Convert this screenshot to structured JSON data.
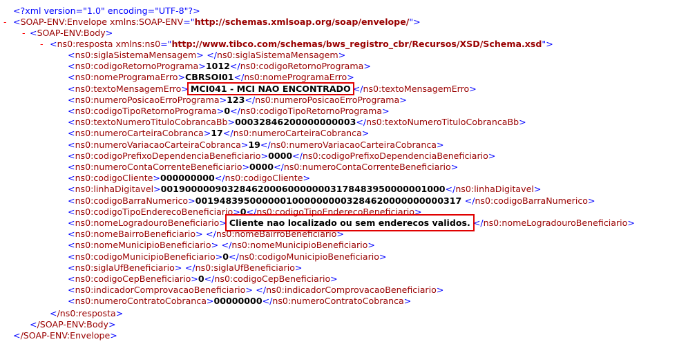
{
  "xml_decl": "<?xml version=\"1.0\" encoding=\"UTF-8\"?>",
  "toggle_symbol": "-",
  "envelope": {
    "open_tag": "SOAP-ENV:Envelope",
    "attr_name": "xmlns:SOAP-ENV",
    "attr_value": "http://schemas.xmlsoap.org/soap/envelope/",
    "close_tag": "/SOAP-ENV:Envelope"
  },
  "body": {
    "open_tag": "SOAP-ENV:Body",
    "close_tag": "/SOAP-ENV:Body"
  },
  "resposta": {
    "open_tag": "ns0:resposta",
    "attr_name": "xmlns:ns0",
    "attr_value": "http://www.tibco.com/schemas/bws_registro_cbr/Recursos/XSD/Schema.xsd",
    "close_tag": "/ns0:resposta"
  },
  "fields": [
    {
      "tag": "ns0:siglaSistemaMensagem",
      "value": " "
    },
    {
      "tag": "ns0:codigoRetornoPrograma",
      "value": "1012"
    },
    {
      "tag": "ns0:nomeProgramaErro",
      "value": "CBRSOI01"
    },
    {
      "tag": "ns0:textoMensagemErro",
      "value": "MCI041 - MCI NAO ENCONTRADO",
      "highlight": true
    },
    {
      "tag": "ns0:numeroPosicaoErroPrograma",
      "value": "123"
    },
    {
      "tag": "ns0:codigoTipoRetornoPrograma",
      "value": "0"
    },
    {
      "tag": "ns0:textoNumeroTituloCobrancaBb",
      "value": "00032846200000000003"
    },
    {
      "tag": "ns0:numeroCarteiraCobranca",
      "value": "17"
    },
    {
      "tag": "ns0:numeroVariacaoCarteiraCobranca",
      "value": "19"
    },
    {
      "tag": "ns0:codigoPrefixoDependenciaBeneficiario",
      "value": "0000"
    },
    {
      "tag": "ns0:numeroContaCorrenteBeneficiario",
      "value": "0000"
    },
    {
      "tag": "ns0:codigoCliente",
      "value": "000000000"
    },
    {
      "tag": "ns0:linhaDigitavel",
      "value": "00190000090328462000600000003178483950000001000"
    },
    {
      "tag": "ns0:codigoBarraNumerico",
      "value": "00194839500000010000000003284620000000000317 "
    },
    {
      "tag": "ns0:codigoTipoEnderecoBeneficiario",
      "value": "0"
    },
    {
      "tag": "ns0:nomeLogradouroBeneficiario",
      "value": "Cliente nao localizado ou sem enderecos validos.",
      "highlight": true
    },
    {
      "tag": "ns0:nomeBairroBeneficiario",
      "value": " "
    },
    {
      "tag": "ns0:nomeMunicipioBeneficiario",
      "value": " "
    },
    {
      "tag": "ns0:codigoMunicipioBeneficiario",
      "value": "0"
    },
    {
      "tag": "ns0:siglaUfBeneficiario",
      "value": " "
    },
    {
      "tag": "ns0:codigoCepBeneficiario",
      "value": "0"
    },
    {
      "tag": "ns0:indicadorComprovacaoBeneficiario",
      "value": " "
    },
    {
      "tag": "ns0:numeroContratoCobranca",
      "value": "00000000"
    }
  ]
}
